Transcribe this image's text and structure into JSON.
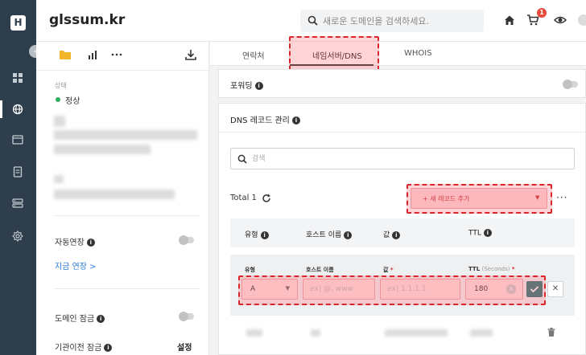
{
  "rail": {
    "logo_letter": "H"
  },
  "header": {
    "domain": "glssum.kr",
    "search_placeholder": "새로운 도메인을 검색하세요.",
    "cart_count": "1"
  },
  "sidepanel": {
    "status_label": "상태",
    "status_value": "정상",
    "auto_renew_label": "자동연장",
    "renew_now_link": "지금 연장 >",
    "domain_lock_label": "도메인 잠금",
    "transfer_lock_label": "기관이전 잠금",
    "transfer_lock_action": "설정"
  },
  "tabs": [
    {
      "label": "연락처",
      "active": false
    },
    {
      "label": "네임서버/DNS",
      "active": true
    },
    {
      "label": "WHOIS",
      "active": false
    }
  ],
  "forwarding": {
    "title": "포워딩"
  },
  "dns": {
    "title": "DNS 레코드 관리",
    "search_placeholder": "검색",
    "total_label": "Total 1",
    "add_record_label": "+ 새 레코드 추가",
    "columns": [
      "유형",
      "호스트 이름",
      "값",
      "TTL"
    ],
    "form": {
      "type_label": "유형",
      "host_label": "호스트 이름",
      "value_label": "값",
      "ttl_label": "TTL",
      "ttl_unit": "(Seconds)",
      "required_mark": "*",
      "type_value": "A",
      "host_placeholder": "ex) @, www",
      "value_placeholder": "ex) 1.1.1.1",
      "ttl_value": "180"
    }
  },
  "colors": {
    "rail_bg": "#2f3e4c",
    "highlight": "#d9262c",
    "confirm": "#2c7a7b",
    "status_ok": "#2eae5b"
  }
}
